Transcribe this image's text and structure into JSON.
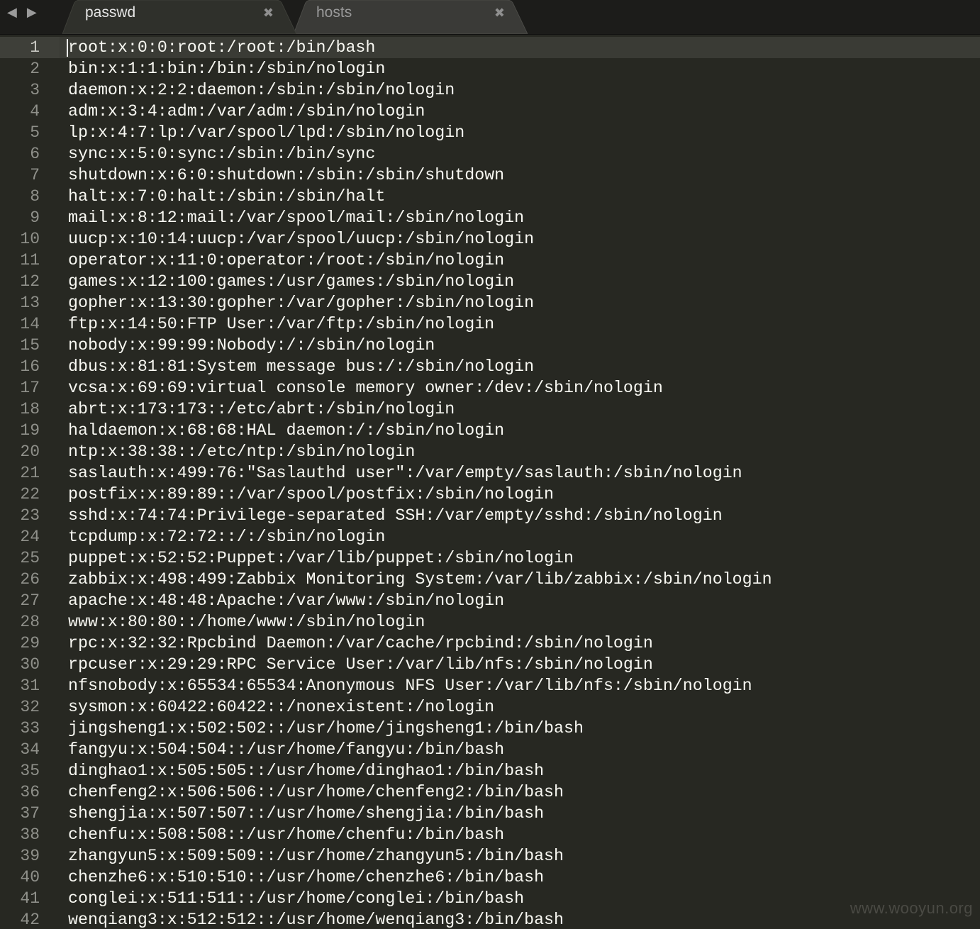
{
  "nav": {
    "back_glyph": "◀",
    "forward_glyph": "▶"
  },
  "tabs": [
    {
      "label": "passwd",
      "close": "✖",
      "active": true
    },
    {
      "label": "hosts",
      "close": "✖",
      "active": false
    }
  ],
  "editor": {
    "current_line": 1,
    "lines": [
      {
        "num": "1",
        "text": "root:x:0:0:root:/root:/bin/bash"
      },
      {
        "num": "2",
        "text": "bin:x:1:1:bin:/bin:/sbin/nologin"
      },
      {
        "num": "3",
        "text": "daemon:x:2:2:daemon:/sbin:/sbin/nologin"
      },
      {
        "num": "4",
        "text": "adm:x:3:4:adm:/var/adm:/sbin/nologin"
      },
      {
        "num": "5",
        "text": "lp:x:4:7:lp:/var/spool/lpd:/sbin/nologin"
      },
      {
        "num": "6",
        "text": "sync:x:5:0:sync:/sbin:/bin/sync"
      },
      {
        "num": "7",
        "text": "shutdown:x:6:0:shutdown:/sbin:/sbin/shutdown"
      },
      {
        "num": "8",
        "text": "halt:x:7:0:halt:/sbin:/sbin/halt"
      },
      {
        "num": "9",
        "text": "mail:x:8:12:mail:/var/spool/mail:/sbin/nologin"
      },
      {
        "num": "10",
        "text": "uucp:x:10:14:uucp:/var/spool/uucp:/sbin/nologin"
      },
      {
        "num": "11",
        "text": "operator:x:11:0:operator:/root:/sbin/nologin"
      },
      {
        "num": "12",
        "text": "games:x:12:100:games:/usr/games:/sbin/nologin"
      },
      {
        "num": "13",
        "text": "gopher:x:13:30:gopher:/var/gopher:/sbin/nologin"
      },
      {
        "num": "14",
        "text": "ftp:x:14:50:FTP User:/var/ftp:/sbin/nologin"
      },
      {
        "num": "15",
        "text": "nobody:x:99:99:Nobody:/:/sbin/nologin"
      },
      {
        "num": "16",
        "text": "dbus:x:81:81:System message bus:/:/sbin/nologin"
      },
      {
        "num": "17",
        "text": "vcsa:x:69:69:virtual console memory owner:/dev:/sbin/nologin"
      },
      {
        "num": "18",
        "text": "abrt:x:173:173::/etc/abrt:/sbin/nologin"
      },
      {
        "num": "19",
        "text": "haldaemon:x:68:68:HAL daemon:/:/sbin/nologin"
      },
      {
        "num": "20",
        "text": "ntp:x:38:38::/etc/ntp:/sbin/nologin"
      },
      {
        "num": "21",
        "text": "saslauth:x:499:76:\"Saslauthd user\":/var/empty/saslauth:/sbin/nologin"
      },
      {
        "num": "22",
        "text": "postfix:x:89:89::/var/spool/postfix:/sbin/nologin"
      },
      {
        "num": "23",
        "text": "sshd:x:74:74:Privilege-separated SSH:/var/empty/sshd:/sbin/nologin"
      },
      {
        "num": "24",
        "text": "tcpdump:x:72:72::/:/sbin/nologin"
      },
      {
        "num": "25",
        "text": "puppet:x:52:52:Puppet:/var/lib/puppet:/sbin/nologin"
      },
      {
        "num": "26",
        "text": "zabbix:x:498:499:Zabbix Monitoring System:/var/lib/zabbix:/sbin/nologin"
      },
      {
        "num": "27",
        "text": "apache:x:48:48:Apache:/var/www:/sbin/nologin"
      },
      {
        "num": "28",
        "text": "www:x:80:80::/home/www:/sbin/nologin"
      },
      {
        "num": "29",
        "text": "rpc:x:32:32:Rpcbind Daemon:/var/cache/rpcbind:/sbin/nologin"
      },
      {
        "num": "30",
        "text": "rpcuser:x:29:29:RPC Service User:/var/lib/nfs:/sbin/nologin"
      },
      {
        "num": "31",
        "text": "nfsnobody:x:65534:65534:Anonymous NFS User:/var/lib/nfs:/sbin/nologin"
      },
      {
        "num": "32",
        "text": "sysmon:x:60422:60422::/nonexistent:/nologin"
      },
      {
        "num": "33",
        "text": "jingsheng1:x:502:502::/usr/home/jingsheng1:/bin/bash"
      },
      {
        "num": "34",
        "text": "fangyu:x:504:504::/usr/home/fangyu:/bin/bash"
      },
      {
        "num": "35",
        "text": "dinghao1:x:505:505::/usr/home/dinghao1:/bin/bash"
      },
      {
        "num": "36",
        "text": "chenfeng2:x:506:506::/usr/home/chenfeng2:/bin/bash"
      },
      {
        "num": "37",
        "text": "shengjia:x:507:507::/usr/home/shengjia:/bin/bash"
      },
      {
        "num": "38",
        "text": "chenfu:x:508:508::/usr/home/chenfu:/bin/bash"
      },
      {
        "num": "39",
        "text": "zhangyun5:x:509:509::/usr/home/zhangyun5:/bin/bash"
      },
      {
        "num": "40",
        "text": "chenzhe6:x:510:510::/usr/home/chenzhe6:/bin/bash"
      },
      {
        "num": "41",
        "text": "conglei:x:511:511::/usr/home/conglei:/bin/bash"
      },
      {
        "num": "42",
        "text": "wenqiang3:x:512:512::/usr/home/wenqiang3:/bin/bash"
      }
    ]
  },
  "watermark": "www.wooyun.org",
  "colors": {
    "background": "#272822",
    "tabbar": "#1c1c1a",
    "active_tab": "#2f302b",
    "inactive_tab": "#3a3a37",
    "text": "#f8f8f2",
    "gutter_text": "#8f908a"
  }
}
